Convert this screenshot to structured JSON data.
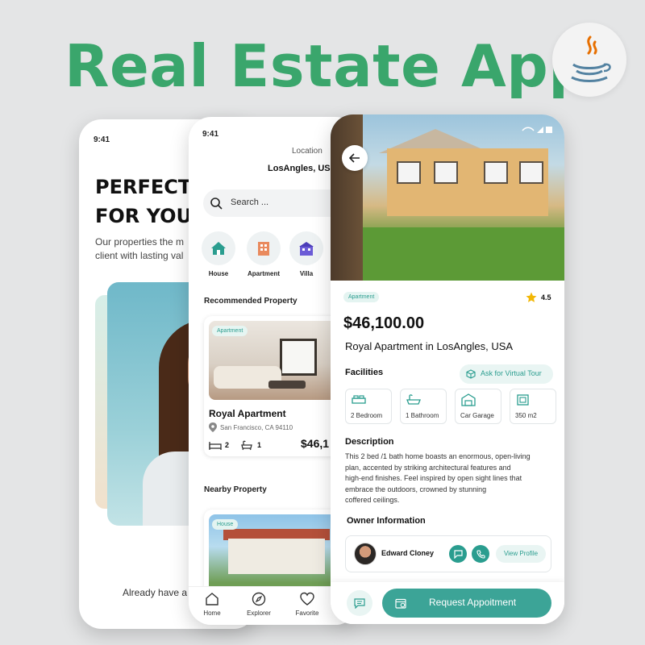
{
  "banner": {
    "title": "Real Estate App"
  },
  "phone1": {
    "time": "9:41",
    "headline": "PERFECT\nFOR YOU",
    "body": "Our properties the m\nclient with lasting val",
    "footer": "Already have a"
  },
  "phone2": {
    "time": "9:41",
    "location_label": "Location",
    "location_value": "LosAngles, USA",
    "search_placeholder": "Search ...",
    "categories": [
      {
        "label": "House",
        "icon": "house-icon"
      },
      {
        "label": "Apartment",
        "icon": "apartment-icon"
      },
      {
        "label": "Villa",
        "icon": "villa-icon"
      }
    ],
    "recommended_title": "Recommended Property",
    "recommended": {
      "badge": "Apartment",
      "name": "Royal Apartment",
      "address": "San Francisco, CA 94110",
      "beds": "2",
      "baths": "1",
      "price": "$46,1"
    },
    "nearby_title": "Nearby Property",
    "nearby": {
      "badge": "House"
    },
    "nav": [
      {
        "label": "Home",
        "icon": "home-icon"
      },
      {
        "label": "Explorer",
        "icon": "compass-icon"
      },
      {
        "label": "Favorite",
        "icon": "heart-icon"
      }
    ]
  },
  "phone3": {
    "badge": "Apartment",
    "rating": "4.5",
    "price": "$46,100.00",
    "name": "Royal Apartment in LosAngles, USA",
    "facilities_title": "Facilities",
    "virtual_tour": "Ask for Virtual Tour",
    "facilities": [
      {
        "label": "2 Bedroom",
        "icon": "bed-icon"
      },
      {
        "label": "1 Bathroom",
        "icon": "bathtub-icon"
      },
      {
        "label": "Car Garage",
        "icon": "garage-icon"
      },
      {
        "label": "350 m2",
        "icon": "area-icon"
      }
    ],
    "description_title": "Description",
    "description": "This 2 bed /1 bath home boasts an enormous, open-living\nplan, accented by striking architectural features and\nhigh-end finishes. Feel inspired by open sight lines that\n embrace the outdoors, crowned by stunning\n coffered ceilings.",
    "owner_title": "Owner Information",
    "owner_name": "Edward Cloney",
    "view_profile": "View Profile",
    "request_button": "Request Appoitment"
  },
  "colors": {
    "brand_green": "#3aa66c",
    "accent_teal": "#2a9d8f",
    "button_teal": "#3ca497",
    "star": "#f2b705"
  }
}
